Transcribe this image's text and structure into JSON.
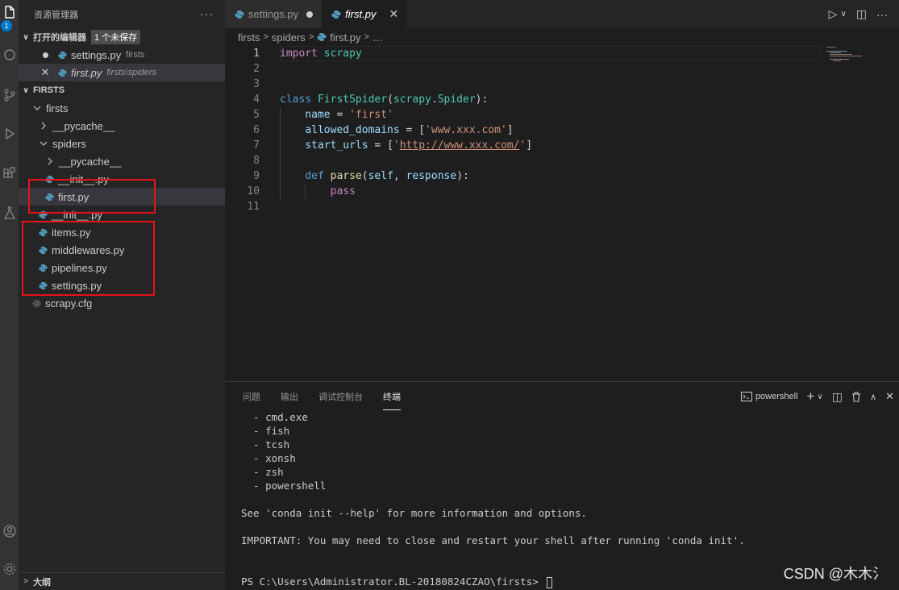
{
  "activity_bar": {
    "badge": "1",
    "icons": [
      "files-icon",
      "search-icon",
      "source-control-icon",
      "run-debug-icon",
      "extensions-icon",
      "testing-icon",
      "account-icon",
      "settings-gear-icon"
    ]
  },
  "sidebar": {
    "title": "资源管理器",
    "more": "···",
    "open_editors": {
      "title": "打开的编辑器",
      "badge": "1 个未保存",
      "items": [
        {
          "label": "settings.py",
          "desc": "firsts"
        },
        {
          "label": "first.py",
          "desc": "firsts\\spiders"
        }
      ]
    },
    "project": {
      "title": "FIRSTS",
      "tree": {
        "firsts": "firsts",
        "pycache1": "__pycache__",
        "spiders": "spiders",
        "pycache2": "__pycache__",
        "init1": "__init__.py",
        "first": "first.py",
        "init2": "__init__.py",
        "items": "items.py",
        "middlewares": "middlewares.py",
        "pipelines": "pipelines.py",
        "settings": "settings.py",
        "scrapycfg": "scrapy.cfg"
      }
    },
    "outline": "大纲"
  },
  "tabs": [
    {
      "label": "settings.py"
    },
    {
      "label": "first.py",
      "close": "✕"
    }
  ],
  "breadcrumb": [
    "firsts",
    "spiders",
    "first.py",
    "…"
  ],
  "editor": {
    "line_numbers": [
      "1",
      "2",
      "3",
      "4",
      "5",
      "6",
      "7",
      "8",
      "9",
      "10",
      "11"
    ]
  },
  "panel": {
    "tabs": [
      "问题",
      "输出",
      "调试控制台",
      "终端"
    ],
    "shell": "powershell",
    "terminal_lines": [
      "  - cmd.exe",
      "  - fish",
      "  - tcsh",
      "  - xonsh",
      "  - zsh",
      "  - powershell",
      "",
      "See 'conda init --help' for more information and options.",
      "",
      "IMPORTANT: You may need to close and restart your shell after running 'conda init'.",
      "",
      ""
    ],
    "prompt": "PS C:\\Users\\Administrator.BL-20180824CZAO\\firsts> "
  },
  "watermark": "CSDN @木木氵",
  "colors": {
    "accent": "#007acc",
    "highlight_box": "#e8121b",
    "python_icon": "#519aba"
  }
}
